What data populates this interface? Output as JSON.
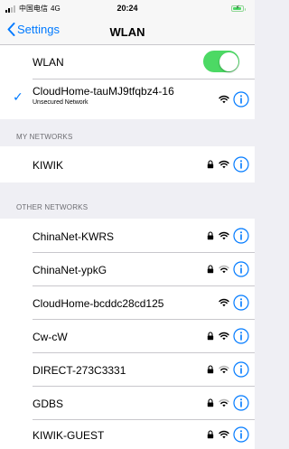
{
  "status_bar": {
    "carrier": "中国电信",
    "network": "4G",
    "time": "20:24",
    "signal_bars_active": 2,
    "signal_bars_total": 4
  },
  "nav": {
    "back_label": "Settings",
    "title": "WLAN"
  },
  "wlan_toggle": {
    "label": "WLAN",
    "on": true
  },
  "connected_network": {
    "name": "CloudHome-tauMJ9tfqbz4-16",
    "subtitle": "Unsecured Network",
    "secured": false
  },
  "my_networks": {
    "header": "MY NETWORKS",
    "items": [
      {
        "name": "KIWIK",
        "secured": true
      }
    ]
  },
  "other_networks": {
    "header": "OTHER NETWORKS",
    "items": [
      {
        "name": "ChinaNet-KWRS",
        "secured": true
      },
      {
        "name": "ChinaNet-ypkG",
        "secured": true
      },
      {
        "name": "CloudHome-bcddc28cd125",
        "secured": false
      },
      {
        "name": "Cw-cW",
        "secured": true
      },
      {
        "name": "DIRECT-273C3331",
        "secured": true
      },
      {
        "name": "GDBS",
        "secured": true
      },
      {
        "name": "KIWIK-GUEST",
        "secured": true
      }
    ]
  },
  "colors": {
    "accent": "#007aff",
    "toggle_on": "#4cd964",
    "background": "#efeff4",
    "separator": "#c8c7cc",
    "section_header": "#6d6d72"
  }
}
